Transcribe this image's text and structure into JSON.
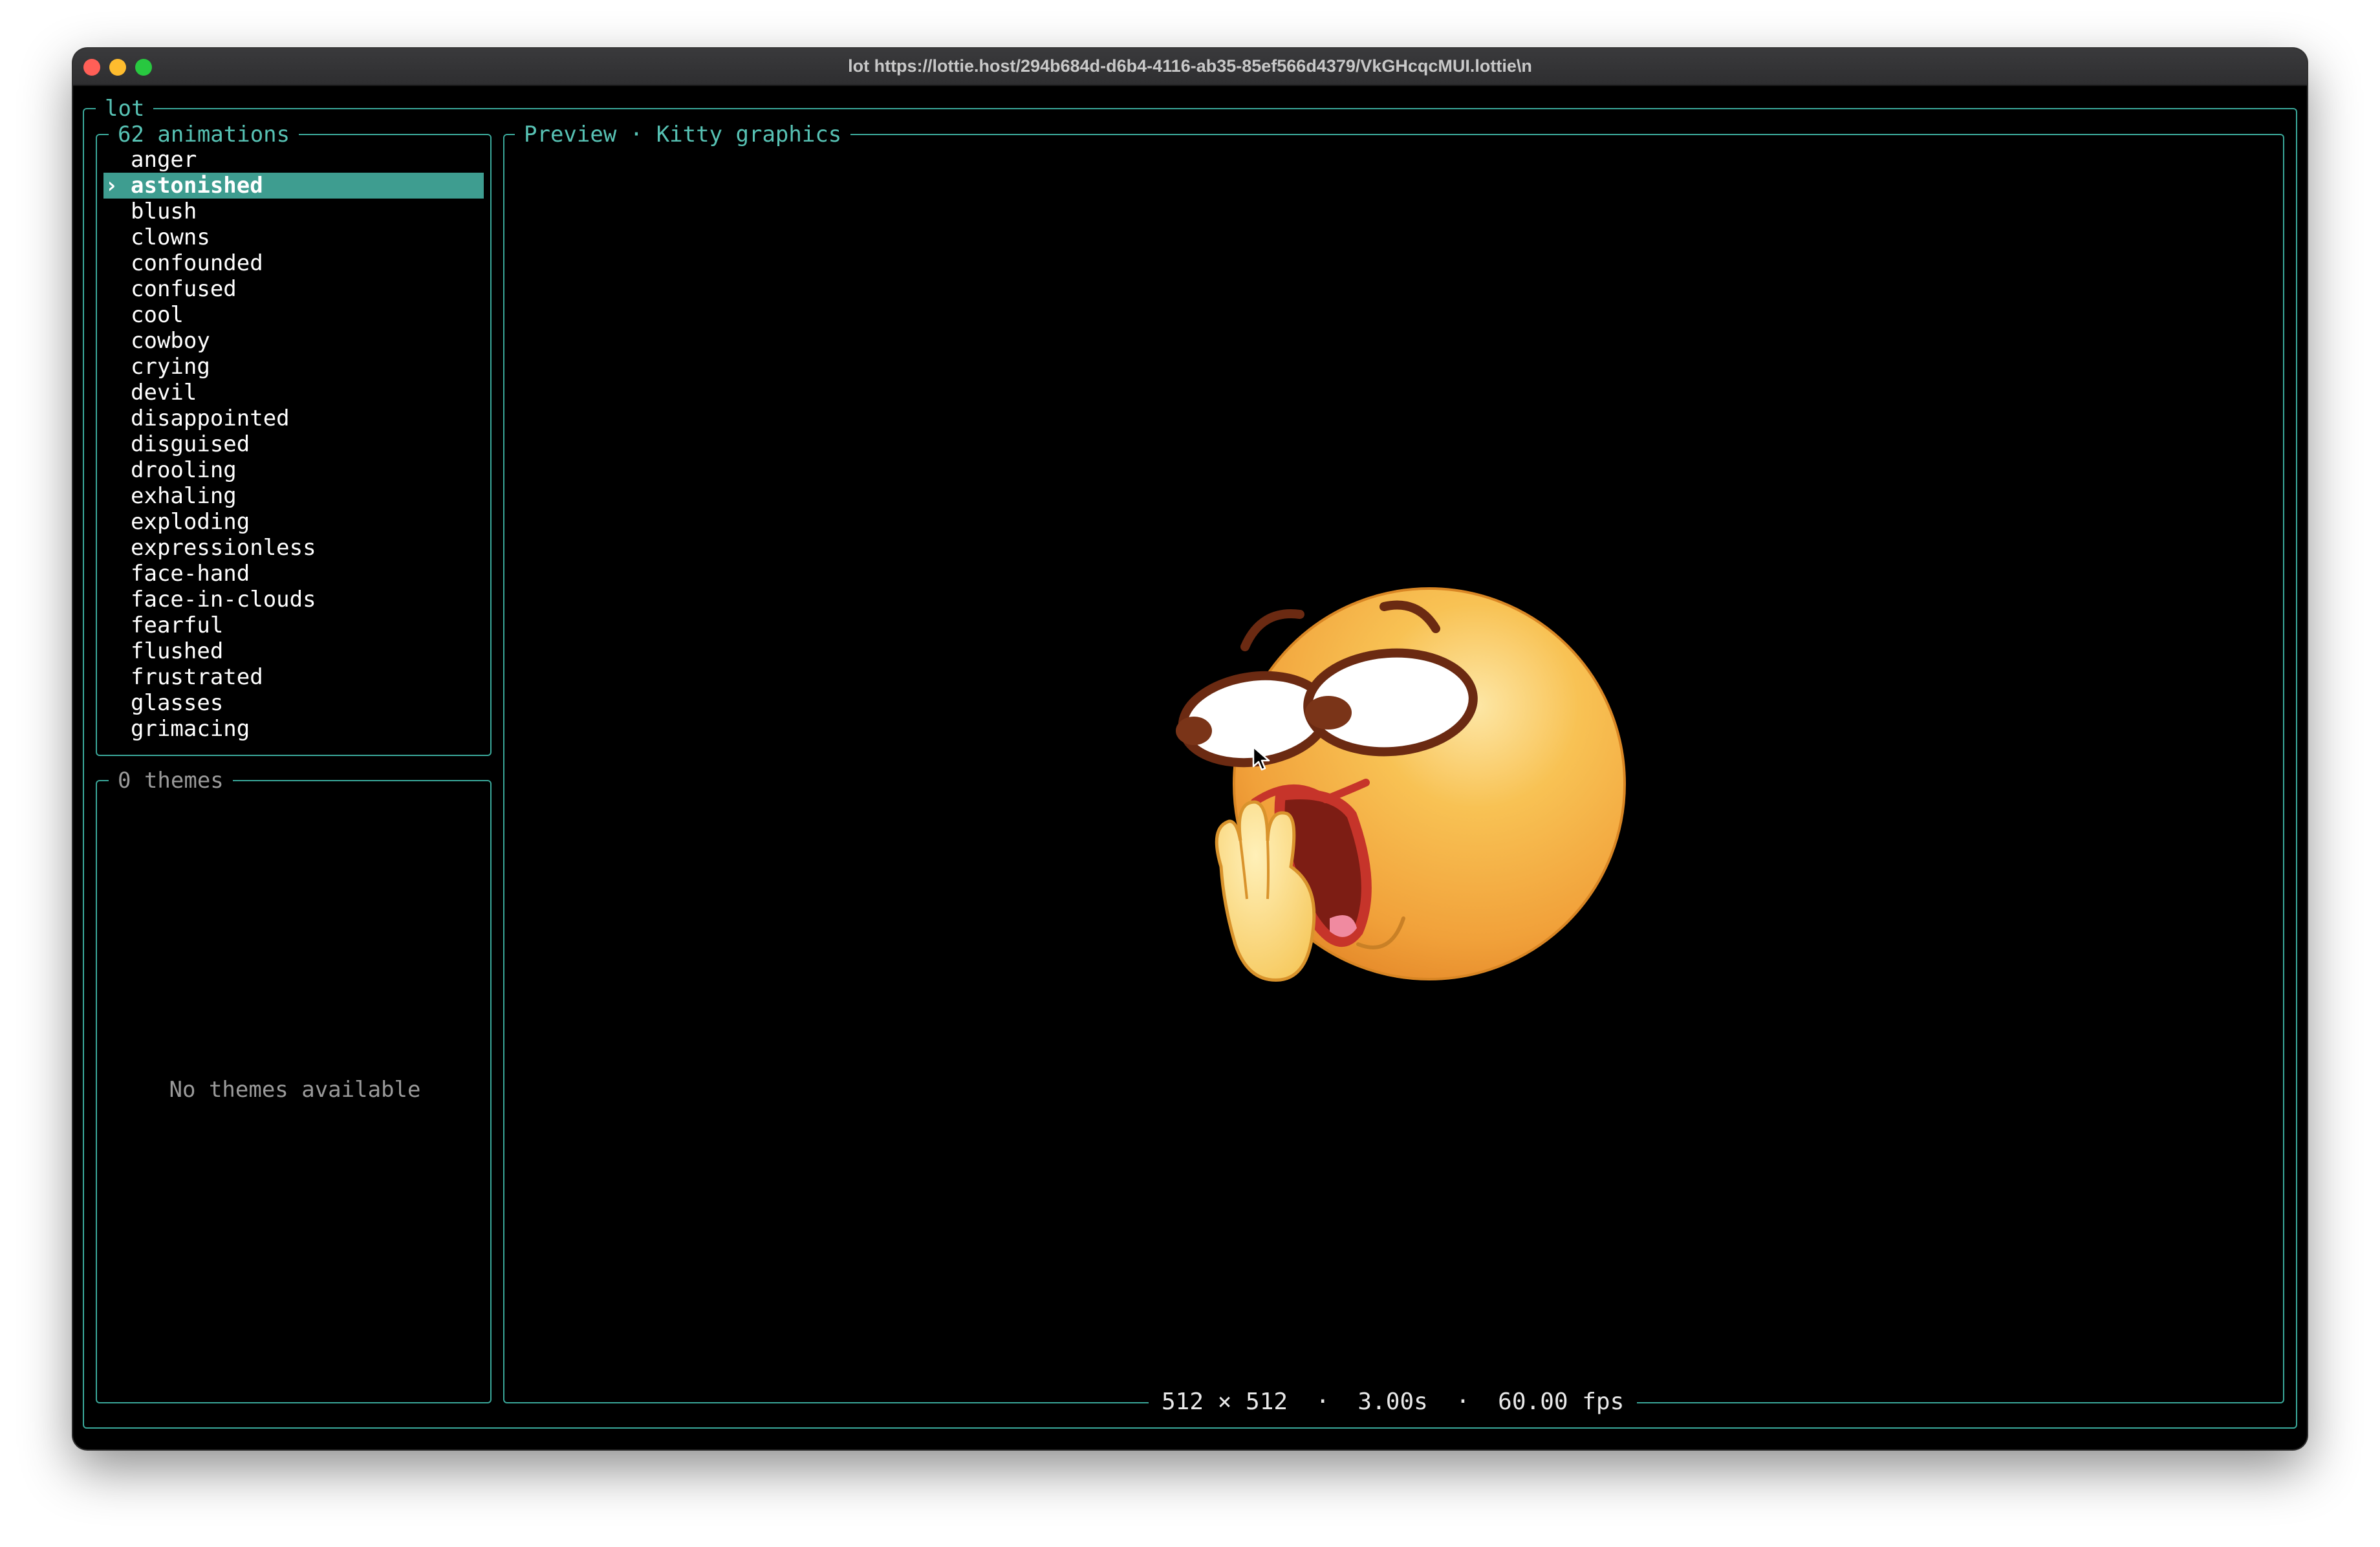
{
  "window": {
    "title": "lot https://lottie.host/294b684d-d6b4-4116-ab35-85ef566d4379/VkGHcqcMUI.lottie\\n"
  },
  "app": {
    "name": "lot"
  },
  "animations": {
    "header": "62 animations",
    "selected_marker": "›",
    "selected_index": 1,
    "items": [
      "anger",
      "astonished",
      "blush",
      "clowns",
      "confounded",
      "confused",
      "cool",
      "cowboy",
      "crying",
      "devil",
      "disappointed",
      "disguised",
      "drooling",
      "exhaling",
      "exploding",
      "expressionless",
      "face-hand",
      "face-in-clouds",
      "fearful",
      "flushed",
      "frustrated",
      "glasses",
      "grimacing"
    ]
  },
  "themes": {
    "header": "0 themes",
    "empty_message": "No themes available"
  },
  "preview": {
    "header": "Preview · Kitty graphics",
    "status": "512 × 512  ·  3.00s  ·  60.00 fps",
    "image_icon": "astonished-emoji-icon"
  },
  "colors": {
    "accent": "#3aa89a",
    "selection_bg": "#3e9d90",
    "background": "#000000"
  }
}
